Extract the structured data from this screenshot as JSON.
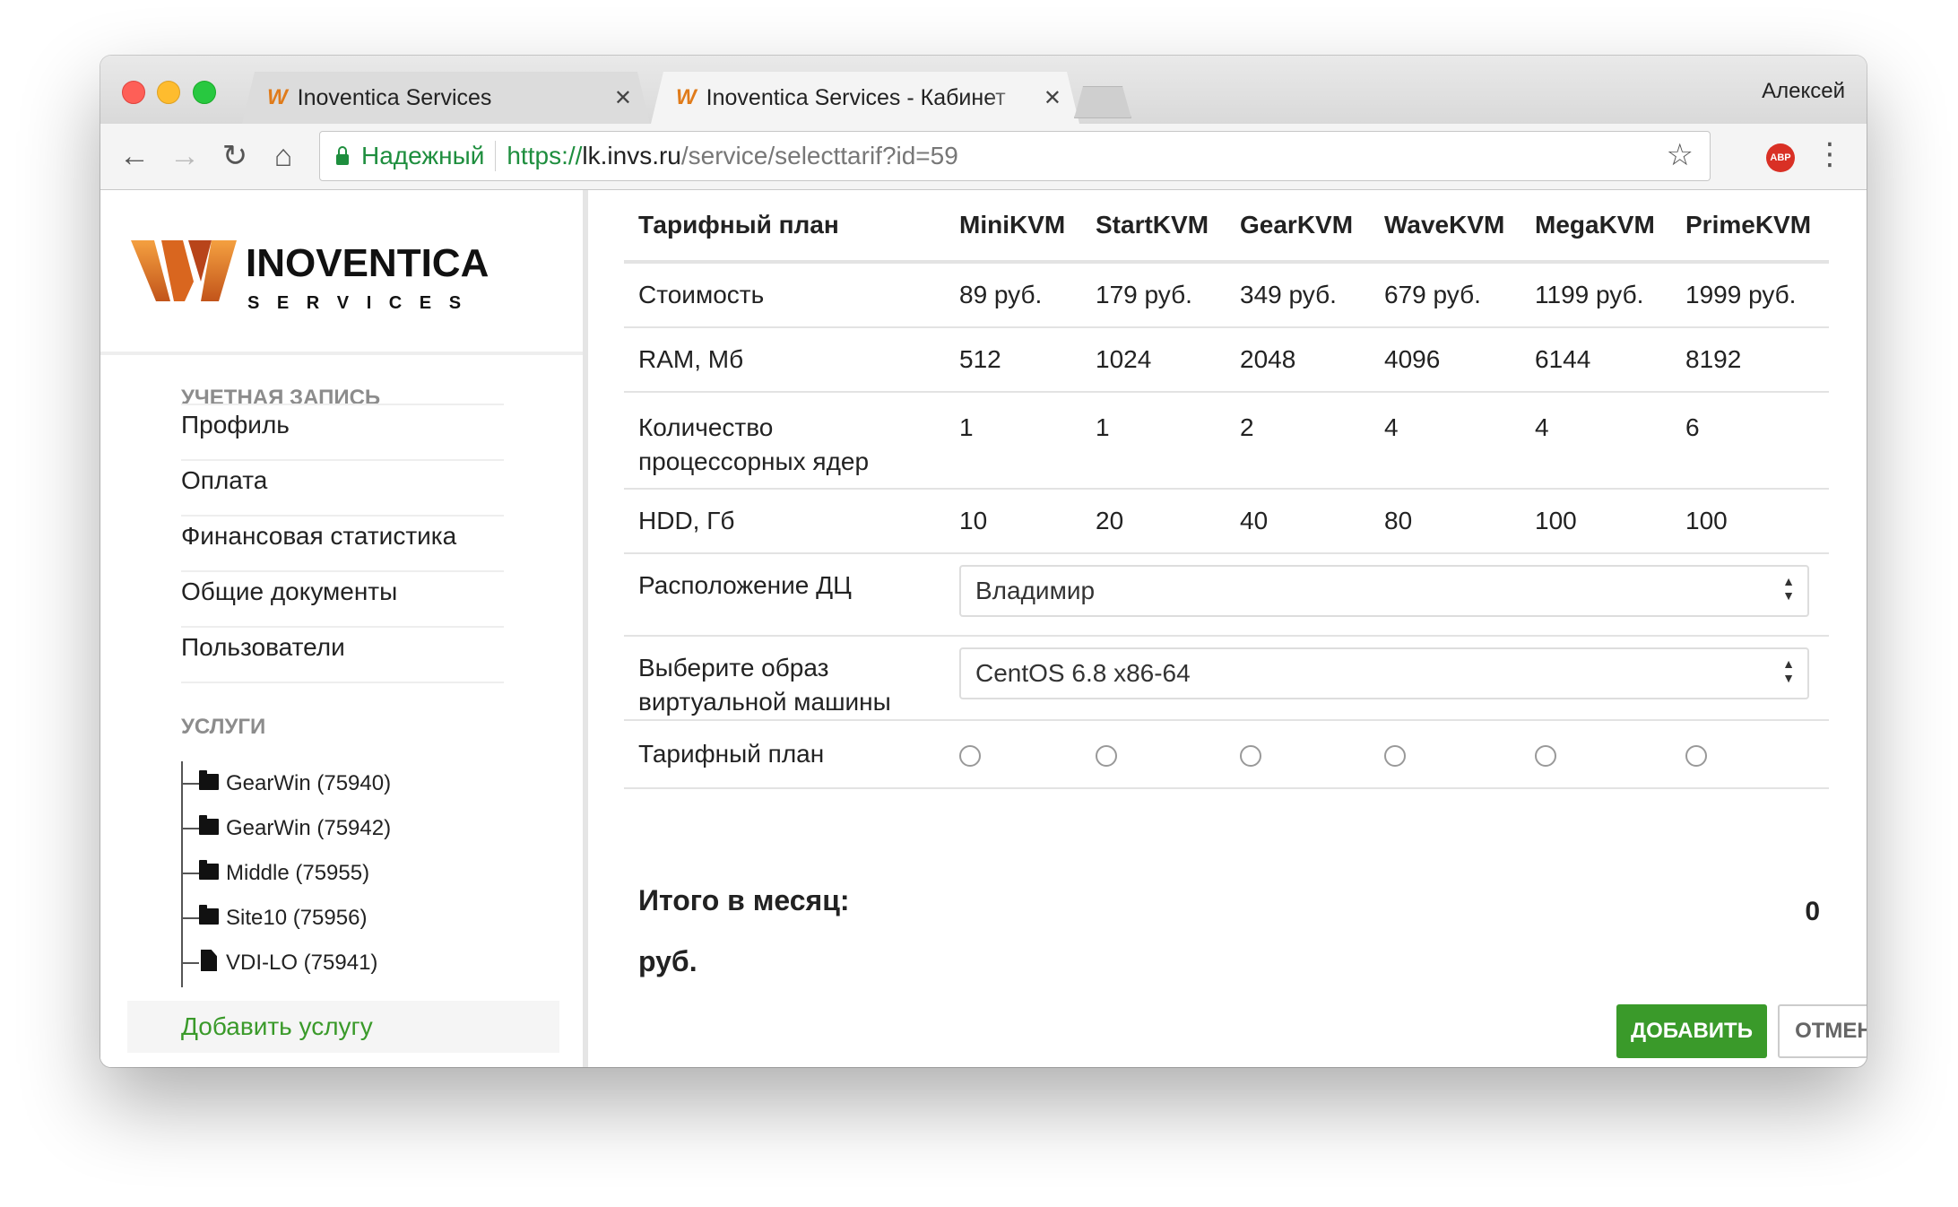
{
  "browser": {
    "tabs": [
      {
        "title": "Inoventica Services",
        "active": false
      },
      {
        "title": "Inoventica Services - Кабинет",
        "active": true
      }
    ],
    "profile_name": "Алексей",
    "secure_label": "Надежный",
    "url": {
      "scheme": "https://",
      "host": "lk.invs.ru",
      "path": "/service/selecttarif?id=59"
    },
    "extension_badge": "ABP"
  },
  "logo": {
    "brand": "INOVENTICA",
    "sub": "S E R V I C E S"
  },
  "sidebar": {
    "account_heading": "УЧЕТНАЯ ЗАПИСЬ",
    "account_items": [
      "Профиль",
      "Оплата",
      "Финансовая статистика",
      "Общие документы",
      "Пользователи"
    ],
    "services_heading": "УСЛУГИ",
    "services": [
      {
        "label": "GearWin (75940)",
        "icon": "folder-icon"
      },
      {
        "label": "GearWin (75942)",
        "icon": "folder-icon"
      },
      {
        "label": "Middle (75955)",
        "icon": "folder-icon"
      },
      {
        "label": "Site10 (75956)",
        "icon": "folder-icon"
      },
      {
        "label": "VDI-LO (75941)",
        "icon": "file-icon"
      }
    ],
    "add_service": "Добавить услугу"
  },
  "plans": {
    "header_label": "Тарифный план",
    "columns": [
      "MiniKVM",
      "StartKVM",
      "GearKVM",
      "WaveKVM",
      "MegaKVM",
      "PrimeKVM"
    ],
    "rows": [
      {
        "label": "Стоимость",
        "values": [
          "89 руб.",
          "179 руб.",
          "349 руб.",
          "679 руб.",
          "1199 руб.",
          "1999 руб."
        ]
      },
      {
        "label": "RAM, Мб",
        "values": [
          "512",
          "1024",
          "2048",
          "4096",
          "6144",
          "8192"
        ]
      },
      {
        "label_line1": "Количество",
        "label_line2": "процессорных ядер",
        "values": [
          "1",
          "1",
          "2",
          "4",
          "4",
          "6"
        ]
      },
      {
        "label": "HDD, Гб",
        "values": [
          "10",
          "20",
          "40",
          "80",
          "100",
          "100"
        ]
      }
    ],
    "datacenter": {
      "label": "Расположение ДЦ",
      "selected": "Владимир"
    },
    "image": {
      "label_line1": "Выберите образ",
      "label_line2": "виртуальной машины",
      "selected": "CentOS 6.8 x86-64"
    },
    "radio_row_label": "Тарифный план"
  },
  "total": {
    "line1": "Итого в месяц:",
    "line2": "руб.",
    "value": "0"
  },
  "actions": {
    "add": "ДОБАВИТЬ",
    "cancel": "ОТМЕНИТЬ"
  },
  "colors": {
    "accent_green": "#3a9a2a",
    "secure_green": "#1e8e3e",
    "logo_orange": "#e07b1a"
  }
}
